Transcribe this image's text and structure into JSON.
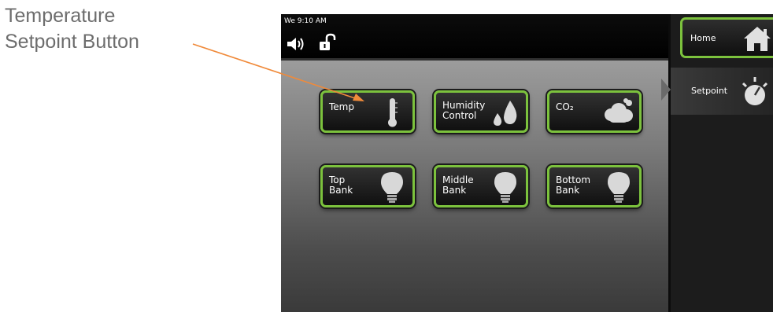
{
  "annotation": {
    "line1": "Temperature",
    "line2": "Setpoint Button",
    "arrow_color": "#f08a3a"
  },
  "status_bar": {
    "datetime": "We 9:10 AM",
    "speaker_icon": "speaker-icon",
    "lock_icon": "unlocked-padlock-icon"
  },
  "tiles": [
    {
      "label": "Temp",
      "icon": "thermometer-icon"
    },
    {
      "label": "Humidity\nControl",
      "icon": "water-drops-icon"
    },
    {
      "label": "CO₂",
      "icon": "cloud-icon"
    },
    {
      "label": "Top\nBank",
      "icon": "light-bulb-icon"
    },
    {
      "label": "Middle\nBank",
      "icon": "light-bulb-icon"
    },
    {
      "label": "Bottom\nBank",
      "icon": "light-bulb-icon"
    }
  ],
  "side_panel": {
    "home_label": "Home",
    "home_icon": "house-icon",
    "setpoint_label": "Setpoint",
    "setpoint_icon": "dial-icon"
  },
  "colors": {
    "tile_border": "#7cc23d",
    "tile_background": "#1a1a1a",
    "panel_background": "#1c1c1c"
  }
}
